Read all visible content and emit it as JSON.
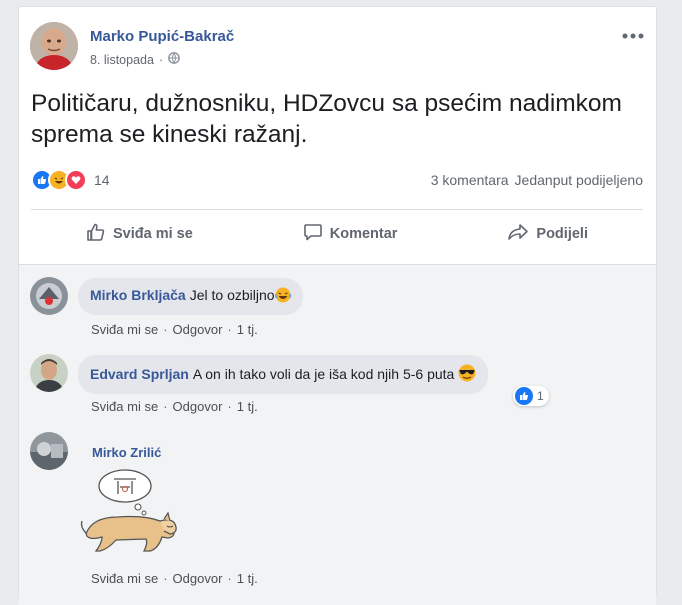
{
  "post": {
    "author": "Marko Pupić-Bakrač",
    "date": "8. listopada",
    "separator": "·",
    "text": "Političaru, dužnosniku, HDZovcu sa psećim nadimkom sprema se kineski ražanj.",
    "reaction_count": "14",
    "comments_count": "3 komentara",
    "shares_count": "Jedanput podijeljeno"
  },
  "actions": {
    "like": "Sviđa mi se",
    "comment": "Komentar",
    "share": "Podijeli"
  },
  "comments": [
    {
      "author": "Mirko Brkljača",
      "text": "Jel to ozbiljno",
      "like": "Sviđa mi se",
      "reply": "Odgovor",
      "dot": "·",
      "time": "1 tj."
    },
    {
      "author": "Edvard Sprljan",
      "text": "A on ih tako voli da je iša kod njih 5-6 puta",
      "like": "Sviđa mi se",
      "reply": "Odgovor",
      "dot": "·",
      "time": "1 tj.",
      "reactions": "1"
    },
    {
      "author": "Mirko Zrilić",
      "text": "",
      "like": "Sviđa mi se",
      "reply": "Odgovor",
      "dot": "·",
      "time": "1 tj."
    }
  ],
  "colors": {
    "link": "#385898",
    "like_blue": "#1877f2",
    "haha_yellow": "#f7b125",
    "love_red": "#f33e58"
  },
  "icons": [
    "globe-icon",
    "more-icon",
    "like-reaction-icon",
    "haha-reaction-icon",
    "love-reaction-icon",
    "thumb-up-icon",
    "comment-icon",
    "share-icon",
    "laughing-emoji-icon",
    "sunglasses-emoji-icon"
  ]
}
